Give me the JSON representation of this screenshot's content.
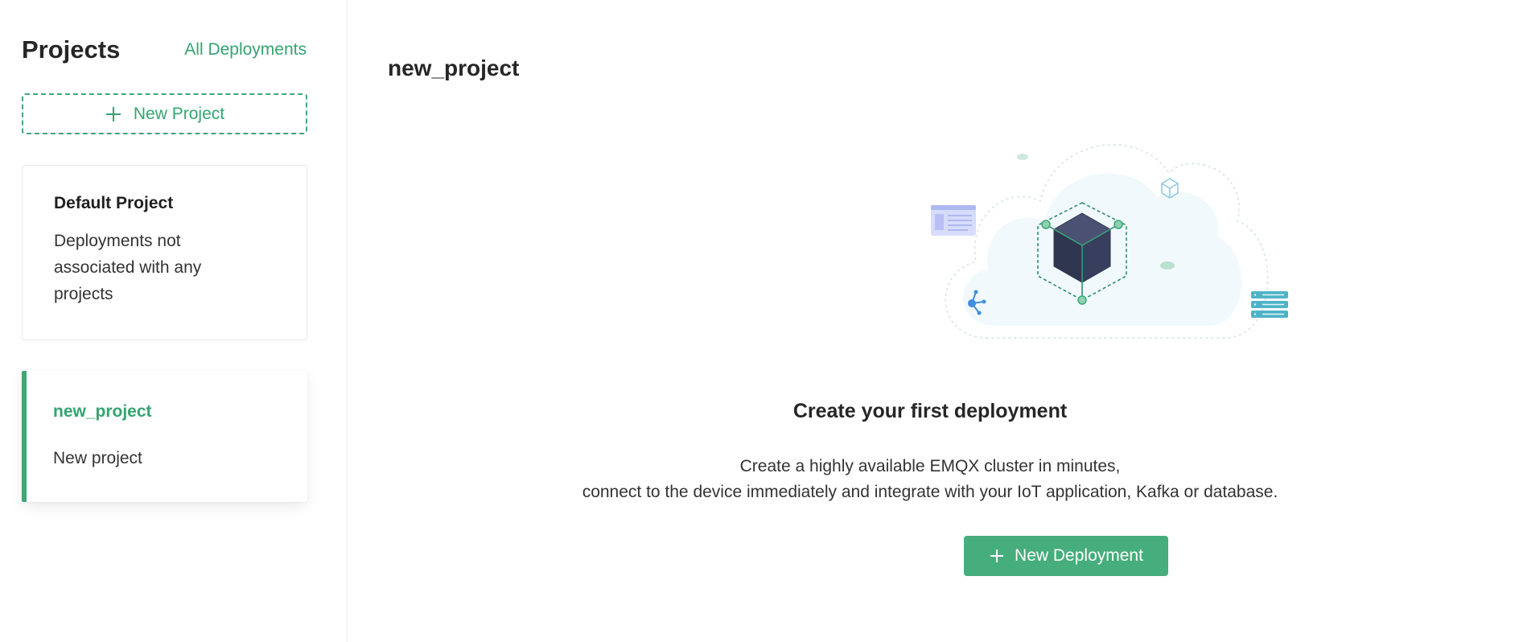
{
  "sidebar": {
    "title": "Projects",
    "all_deployments_link": "All Deployments",
    "new_project_label": "New Project",
    "projects": [
      {
        "name": "Default Project",
        "description": "Deployments not associated with any projects",
        "active": false
      },
      {
        "name": "new_project",
        "description": "New project",
        "active": true
      }
    ]
  },
  "main": {
    "page_title": "new_project",
    "empty_state": {
      "title": "Create your first deployment",
      "description_line1": "Create a highly available EMQX cluster in minutes,",
      "description_line2": "connect to the device immediately and integrate with your IoT application, Kafka or database.",
      "button_label": "New Deployment"
    }
  },
  "colors": {
    "accent": "#3ea876",
    "button_bg": "#46ad7c",
    "cube_dark": "#2f3650",
    "cloud_bg": "#f1f9fc"
  },
  "icons": {
    "plus": "plus-icon",
    "illustration": "cloud-cube-illustration"
  }
}
